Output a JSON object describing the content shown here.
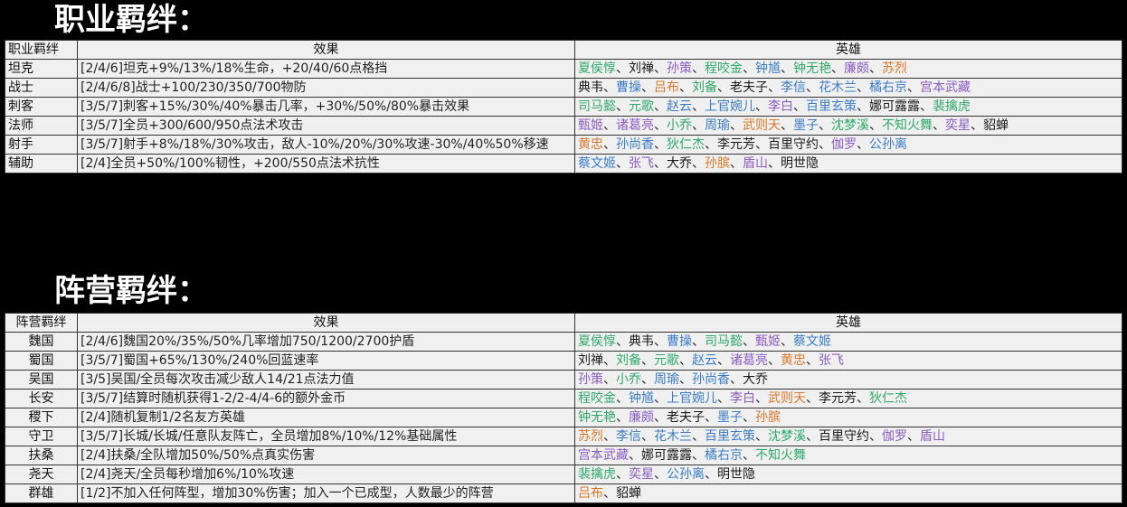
{
  "colors": {
    "g": "#2fa86a",
    "k": "#1a1a1a",
    "p": "#8a5cc0",
    "b": "#3b7cc4",
    "o": "#d9782a"
  },
  "class_section": {
    "title": "职业羁绊：",
    "headers": [
      "职业羁绊",
      "效果",
      "英雄"
    ],
    "rows": [
      {
        "name": "坦克",
        "effect": "[2/4/6]坦克+9%/13%/18%生命，+20/40/60点格挡",
        "heroes": [
          [
            "夏侯惇",
            "g"
          ],
          [
            "刘禅",
            "k"
          ],
          [
            "孙策",
            "p"
          ],
          [
            "程咬金",
            "g"
          ],
          [
            "钟馗",
            "b"
          ],
          [
            "钟无艳",
            "g"
          ],
          [
            "廉颇",
            "p"
          ],
          [
            "苏烈",
            "o"
          ]
        ]
      },
      {
        "name": "战士",
        "effect": "[2/4/6/8]战士+100/230/350/700物防",
        "heroes": [
          [
            "典韦",
            "k"
          ],
          [
            "曹操",
            "b"
          ],
          [
            "吕布",
            "o"
          ],
          [
            "刘备",
            "g"
          ],
          [
            "老夫子",
            "k"
          ],
          [
            "李信",
            "b"
          ],
          [
            "花木兰",
            "b"
          ],
          [
            "橘右京",
            "b"
          ],
          [
            "宫本武藏",
            "p"
          ]
        ]
      },
      {
        "name": "刺客",
        "effect": "[3/5/7]刺客+15%/30%/40%暴击几率，+30%/50%/80%暴击效果",
        "heroes": [
          [
            "司马懿",
            "g"
          ],
          [
            "元歌",
            "g"
          ],
          [
            "赵云",
            "b"
          ],
          [
            "上官婉儿",
            "b"
          ],
          [
            "李白",
            "p"
          ],
          [
            "百里玄策",
            "b"
          ],
          [
            "娜可露露",
            "k"
          ],
          [
            "裴擒虎",
            "g"
          ]
        ]
      },
      {
        "name": "法师",
        "effect": "[3/5/7]全员+300/600/950点法术攻击",
        "heroes": [
          [
            "甄姬",
            "p"
          ],
          [
            "诸葛亮",
            "p"
          ],
          [
            "小乔",
            "g"
          ],
          [
            "周瑜",
            "b"
          ],
          [
            "武则天",
            "o"
          ],
          [
            "墨子",
            "b"
          ],
          [
            "沈梦溪",
            "g"
          ],
          [
            "不知火舞",
            "g"
          ],
          [
            "奕星",
            "p"
          ],
          [
            "貂蝉",
            "k"
          ]
        ]
      },
      {
        "name": "射手",
        "effect": "[3/5/7]射手+8%/18%/30%攻击，敌人-10%/20%/30%攻速-30%/40%50%移速",
        "heroes": [
          [
            "黄忠",
            "o"
          ],
          [
            "孙尚香",
            "b"
          ],
          [
            "狄仁杰",
            "g"
          ],
          [
            "李元芳",
            "k"
          ],
          [
            "百里守约",
            "k"
          ],
          [
            "伽罗",
            "p"
          ],
          [
            "公孙离",
            "b"
          ]
        ]
      },
      {
        "name": "辅助",
        "effect": "[2/4]全员+50%/100%韧性，+200/550点法术抗性",
        "heroes": [
          [
            "蔡文姬",
            "b"
          ],
          [
            "张飞",
            "p"
          ],
          [
            "大乔",
            "k"
          ],
          [
            "孙膑",
            "o"
          ],
          [
            "盾山",
            "p"
          ],
          [
            "明世隐",
            "k"
          ]
        ]
      }
    ]
  },
  "faction_section": {
    "title": "阵营羁绊：",
    "headers": [
      "阵营羁绊",
      "效果",
      "英雄"
    ],
    "rows": [
      {
        "name": "魏国",
        "effect": "[2/4/6]魏国20%/35%/50%几率增加750/1200/2700护盾",
        "heroes": [
          [
            "夏侯惇",
            "g"
          ],
          [
            "典韦",
            "k"
          ],
          [
            "曹操",
            "b"
          ],
          [
            "司马懿",
            "g"
          ],
          [
            "甄姬",
            "p"
          ],
          [
            "蔡文姬",
            "b"
          ]
        ]
      },
      {
        "name": "蜀国",
        "effect": "[3/5/7]蜀国+65%/130%/240%回蓝速率",
        "heroes": [
          [
            "刘禅",
            "k"
          ],
          [
            "刘备",
            "g"
          ],
          [
            "元歌",
            "g"
          ],
          [
            "赵云",
            "b"
          ],
          [
            "诸葛亮",
            "p"
          ],
          [
            "黄忠",
            "o"
          ],
          [
            "张飞",
            "p"
          ]
        ]
      },
      {
        "name": "吴国",
        "effect": "[3/5]吴国/全员每次攻击减少敌人14/21点法力值",
        "heroes": [
          [
            "孙策",
            "p"
          ],
          [
            "小乔",
            "g"
          ],
          [
            "周瑜",
            "b"
          ],
          [
            "孙尚香",
            "b"
          ],
          [
            "大乔",
            "k"
          ]
        ]
      },
      {
        "name": "长安",
        "effect": "[3/5/7]结算时随机获得1-2/2-4/4-6的额外金币",
        "heroes": [
          [
            "程咬金",
            "g"
          ],
          [
            "钟馗",
            "b"
          ],
          [
            "上官婉儿",
            "b"
          ],
          [
            "李白",
            "p"
          ],
          [
            "武则天",
            "o"
          ],
          [
            "李元芳",
            "k"
          ],
          [
            "狄仁杰",
            "g"
          ]
        ]
      },
      {
        "name": "稷下",
        "effect": "[2/4]随机复制1/2名友方英雄",
        "heroes": [
          [
            "钟无艳",
            "g"
          ],
          [
            "廉颇",
            "p"
          ],
          [
            "老夫子",
            "k"
          ],
          [
            "墨子",
            "b"
          ],
          [
            "孙膑",
            "o"
          ]
        ]
      },
      {
        "name": "守卫",
        "effect": "[3/5/7]长城/长城/任意队友阵亡，全员增加8%/10%/12%基础属性",
        "heroes": [
          [
            "苏烈",
            "o"
          ],
          [
            "李信",
            "b"
          ],
          [
            "花木兰",
            "b"
          ],
          [
            "百里玄策",
            "b"
          ],
          [
            "沈梦溪",
            "g"
          ],
          [
            "百里守约",
            "k"
          ],
          [
            "伽罗",
            "p"
          ],
          [
            "盾山",
            "p"
          ]
        ]
      },
      {
        "name": "扶桑",
        "effect": "[2/4]扶桑/全队增加50%/50%点真实伤害",
        "heroes": [
          [
            "宫本武藏",
            "p"
          ],
          [
            "娜可露露",
            "k"
          ],
          [
            "橘右京",
            "b"
          ],
          [
            "不知火舞",
            "g"
          ]
        ]
      },
      {
        "name": "尧天",
        "effect": "[2/4]尧天/全员每秒增加6%/10%攻速",
        "heroes": [
          [
            "裴擒虎",
            "g"
          ],
          [
            "奕星",
            "p"
          ],
          [
            "公孙离",
            "b"
          ],
          [
            "明世隐",
            "k"
          ]
        ]
      },
      {
        "name": "群雄",
        "effect": "[1/2]不加入任何阵型，增加30%伤害；加入一个已成型，人数最少的阵营",
        "heroes": [
          [
            "吕布",
            "o"
          ],
          [
            "貂蝉",
            "k"
          ]
        ]
      }
    ]
  },
  "separator": "、"
}
